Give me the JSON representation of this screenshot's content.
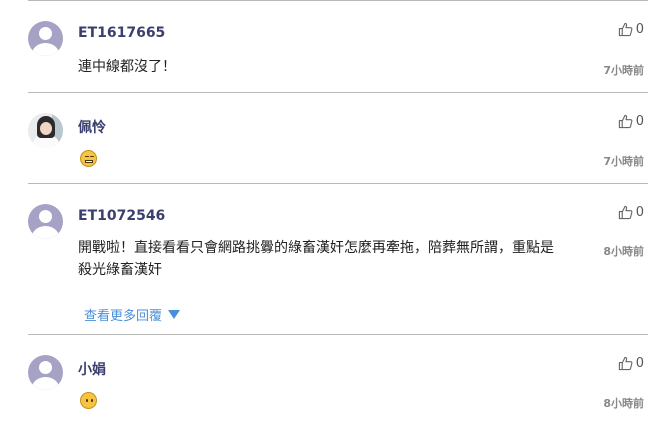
{
  "comments": [
    {
      "username": "ET1617665",
      "text": "連中線都沒了！",
      "likes": "0",
      "time": "7小時前",
      "avatar": "default"
    },
    {
      "username": "佩怜",
      "emoji": "grimacing-face",
      "likes": "0",
      "time": "7小時前",
      "avatar": "photo"
    },
    {
      "username": "ET1072546",
      "text": "開戰啦！直接看看只會網路挑釁的綠畜漢奸怎麼再牽拖，陪葬無所謂，重點是殺光綠畜漢奸",
      "likes": "0",
      "time": "8小時前",
      "avatar": "default",
      "more_label": "查看更多回覆"
    },
    {
      "username": "小娟",
      "emoji": "neutral-face",
      "likes": "0",
      "time": "8小時前",
      "avatar": "default"
    }
  ],
  "colors": {
    "username": "#3b3f6d",
    "more_link": "#4a90d9",
    "avatar": "#a6a2c5",
    "divider": "#b9b9b9"
  }
}
